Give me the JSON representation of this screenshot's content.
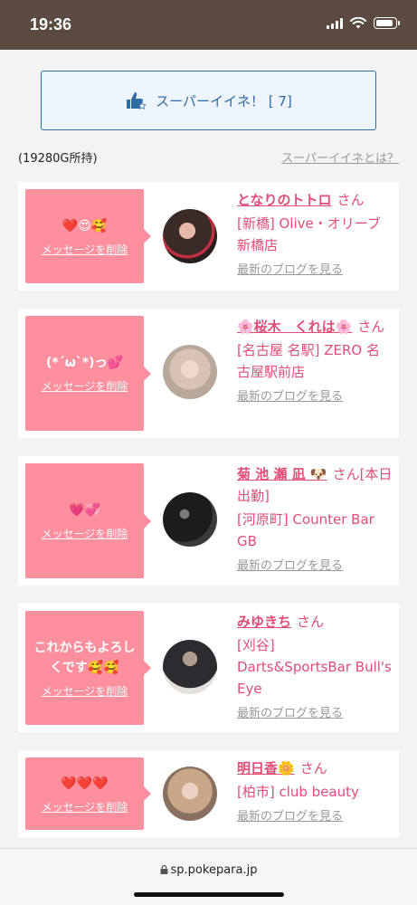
{
  "status": {
    "time": "19:36"
  },
  "super_button": {
    "label": "スーパーイイネ！ [ 7]"
  },
  "owned_text": "(19280G所持)",
  "what_link": "スーパーイイネとは？",
  "cards": [
    {
      "message": "❤️😍🥰",
      "delete_label": "メッセージを削除",
      "name": "となりのトトロ",
      "san": "さん",
      "shop": "[新橋] Olive・オリーブ新橋店",
      "blog": "最新のブログを見る"
    },
    {
      "message": "(*´ω`*)っ💕",
      "delete_label": "メッセージを削除",
      "name": "🌸桜木　くれは🌸",
      "san": "さん",
      "shop": "[名古屋 名駅] ZERO 名古屋駅前店",
      "blog": "最新のブログを見る"
    },
    {
      "message": "💗💞",
      "delete_label": "メッセージを削除",
      "name": "菊 池 瀬 凪 🐶",
      "san": "さん[本日出勤]",
      "shop": "[河原町] Counter Bar GB",
      "blog": "最新のブログを見る"
    },
    {
      "message": "これからもよろしくです🥰🥰",
      "delete_label": "メッセージを削除",
      "name": "みゆきち",
      "san": "さん",
      "shop": "[刈谷] Darts&SportsBar Bull's Eye",
      "blog": "最新のブログを見る"
    },
    {
      "message": "❤️❤️❤️",
      "delete_label": "メッセージを削除",
      "name": "明日香🌼",
      "san": "さん",
      "shop": "[柏市] club beauty",
      "blog": "最新のブログを見る"
    }
  ],
  "urlbar": {
    "url": "sp.pokepara.jp"
  }
}
